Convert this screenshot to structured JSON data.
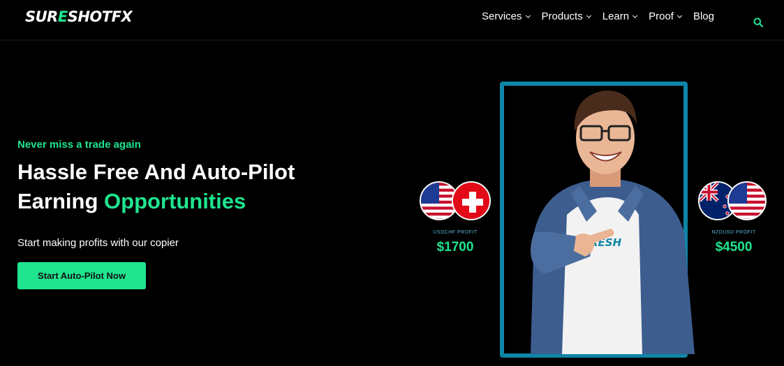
{
  "header": {
    "logo": {
      "part1": "SUR",
      "part2": "E",
      "part3": "SHOTFX"
    },
    "nav": [
      {
        "label": "Services",
        "has_dropdown": true
      },
      {
        "label": "Products",
        "has_dropdown": true
      },
      {
        "label": "Learn",
        "has_dropdown": true
      },
      {
        "label": "Proof",
        "has_dropdown": true
      },
      {
        "label": "Blog",
        "has_dropdown": false
      }
    ],
    "search_icon": "search-icon"
  },
  "hero": {
    "tagline": "Never miss a trade again",
    "headline_line1": "Hassle Free And Auto-Pilot",
    "headline_line2_plain": "Earning ",
    "headline_line2_highlight": "Opportunities",
    "subtext": "Start making profits with our copier",
    "cta_label": "Start Auto-Pilot Now"
  },
  "profit_cards": [
    {
      "label": "USDCHF  PROFIT",
      "value": "$1700",
      "flags": [
        "us-flag",
        "swiss-flag"
      ]
    },
    {
      "label": "NZDUSD  PROFIT",
      "value": "$4500",
      "flags": [
        "nz-flag",
        "us-flag"
      ]
    }
  ],
  "shirt_logo": "RESH",
  "colors": {
    "accent": "#1fe58f",
    "frame": "#0e86a8",
    "background": "#000000"
  }
}
